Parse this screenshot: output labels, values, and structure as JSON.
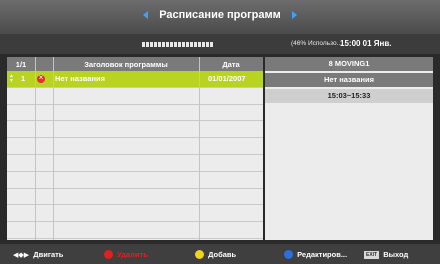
{
  "header": {
    "title": "Расписание программ"
  },
  "subbar": {
    "percent": "(46% Использо...",
    "clock": "15:00 01 Янв."
  },
  "table": {
    "columns": {
      "index": "1/1",
      "title": "Заголовок программы",
      "date": "Дата"
    },
    "selected_row": {
      "number": "1",
      "title": "Нет названия",
      "date": "01/01/2007"
    }
  },
  "details": {
    "channel": "8 MOVING1",
    "program": "Нет названия",
    "time": "15:03~15:33"
  },
  "footer": {
    "move": "Двигать",
    "delete": "Удалить",
    "add": "Добавь",
    "edit": "Редактиров...",
    "exit_key": "EXIT",
    "exit": "Выход",
    "colors": {
      "red": "#e02020",
      "yellow": "#f2d31b",
      "blue": "#2b6fe0",
      "highlight": "#b8d321"
    }
  }
}
